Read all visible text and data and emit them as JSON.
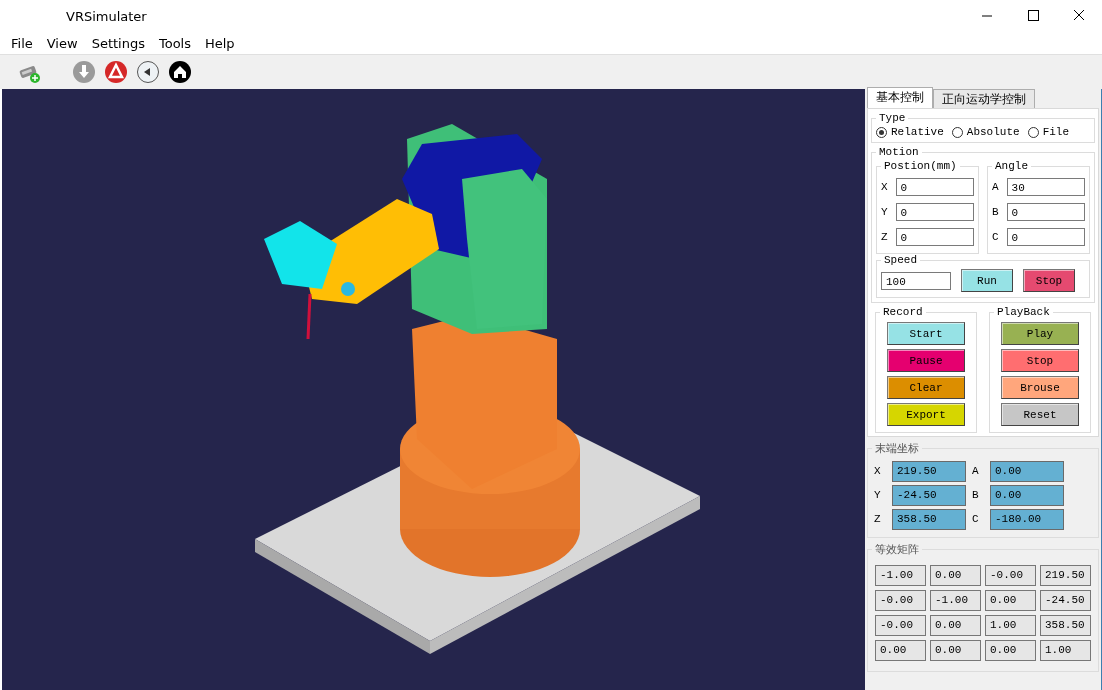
{
  "window": {
    "title": "VRSimulater"
  },
  "menu": [
    "File",
    "View",
    "Settings",
    "Tools",
    "Help"
  ],
  "panel": {
    "tabs": [
      {
        "label": "基本控制",
        "selected": true
      },
      {
        "label": "正向运动学控制",
        "selected": false
      }
    ],
    "type": {
      "title": "Type",
      "options": [
        {
          "label": "Relative",
          "selected": true
        },
        {
          "label": "Absolute",
          "selected": false
        },
        {
          "label": "File",
          "selected": false
        }
      ]
    },
    "motion": {
      "title": "Motion",
      "position": {
        "title": "Postion(mm)",
        "fields": [
          {
            "label": "X",
            "value": "0"
          },
          {
            "label": "Y",
            "value": "0"
          },
          {
            "label": "Z",
            "value": "0"
          }
        ]
      },
      "angle": {
        "title": "Angle",
        "fields": [
          {
            "label": "A",
            "value": "30"
          },
          {
            "label": "B",
            "value": "0"
          },
          {
            "label": "C",
            "value": "0"
          }
        ]
      }
    },
    "speed": {
      "title": "Speed",
      "value": "100",
      "buttons": [
        {
          "label": "Run",
          "color": "#96e2e5"
        },
        {
          "label": "Stop",
          "color": "#e54a70"
        }
      ]
    },
    "record": {
      "title": "Record",
      "buttons": [
        {
          "label": "Start",
          "color": "#96e2e5"
        },
        {
          "label": "Pause",
          "color": "#e5006f"
        },
        {
          "label": "Clear",
          "color": "#dc8e00"
        },
        {
          "label": "Export",
          "color": "#d6d600"
        }
      ]
    },
    "playback": {
      "title": "PlayBack",
      "buttons": [
        {
          "label": "Play",
          "color": "#98b152"
        },
        {
          "label": "Stop",
          "color": "#ff6e70"
        },
        {
          "label": "Brouse",
          "color": "#ffa67c"
        },
        {
          "label": "Reset",
          "color": "#c6c6c6"
        }
      ]
    },
    "end_coords": {
      "title": "末端坐标",
      "fields": [
        {
          "label": "X",
          "value": "219.50"
        },
        {
          "label": "A",
          "value": "0.00"
        },
        {
          "label": "Y",
          "value": "-24.50"
        },
        {
          "label": "B",
          "value": "0.00"
        },
        {
          "label": "Z",
          "value": "358.50"
        },
        {
          "label": "C",
          "value": "-180.00"
        }
      ]
    },
    "matrix": {
      "title": "等效矩阵",
      "rows": [
        [
          "-1.00",
          "0.00",
          "-0.00",
          "219.50"
        ],
        [
          "-0.00",
          "-1.00",
          "0.00",
          "-24.50"
        ],
        [
          "-0.00",
          "0.00",
          "1.00",
          "358.50"
        ],
        [
          "0.00",
          "0.00",
          "0.00",
          "1.00"
        ]
      ]
    }
  }
}
